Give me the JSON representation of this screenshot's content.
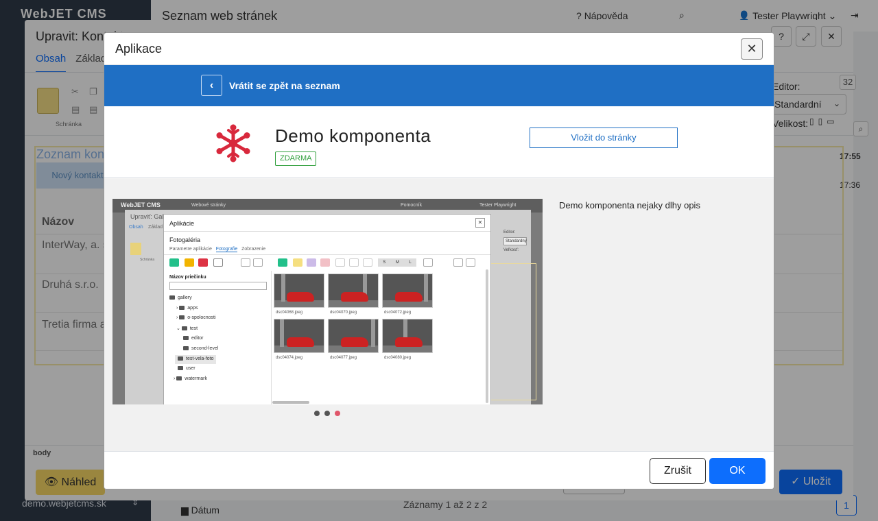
{
  "background": {
    "logo": "WebJET CMS",
    "page_title": "Seznam web stránek",
    "help_label": "Nápověda",
    "user_label": "Tester Playwright",
    "domain": "demo.webjetcms.sk",
    "records_text": "Záznamy 1 až 2 z 2",
    "page_number": "1",
    "folder_label": "Dátum"
  },
  "editor": {
    "title": "Upravit: Kontakt",
    "tabs": [
      {
        "label": "Obsah",
        "active": true
      },
      {
        "label": "Základní",
        "active": false
      }
    ],
    "clipboard_label": "Schránka",
    "editor_label": "Editor:",
    "editor_select_value": "Standardní",
    "size_label": "Velikost:",
    "content_heading": "Zoznam kontaktov",
    "content_button": "Nový kontakt",
    "content_column": "Názov",
    "content_rows": [
      "InterWay, a. s.",
      "Druhá s.r.o.",
      "Tretia firma a.s."
    ],
    "body_label": "body",
    "preview_label": "Náhled",
    "save_label": "Uložit",
    "side_number": "32",
    "time_1": "17:55",
    "time_2": "17:36"
  },
  "modal": {
    "title": "Aplikace",
    "back_label": "Vrátit se zpět na seznam",
    "app_name": "Demo komponenta",
    "badge": "ZDARMA",
    "insert_label": "Vložit do stránky",
    "description": "Demo komponenta nejaky dlhy opis",
    "cancel_label": "Zrušit",
    "ok_label": "OK",
    "carousel": {
      "total": 3,
      "active_index": 2
    }
  },
  "screenshot": {
    "logo": "WebJET CMS",
    "top_title": "Webové stránky",
    "top_help": "Pomocník",
    "top_user": "Tester Playwright",
    "editor_title": "Upraviť: Galéria",
    "tab_obsah": "Obsah",
    "tab_zaklad": "Základ",
    "window_title": "Aplikácie",
    "subtitle": "Fotogaléria",
    "tabs": [
      "Parametre aplikácie",
      "Fotografie",
      "Zobrazenie"
    ],
    "active_tab": "Fotografie",
    "tree_label": "Názov priečinku",
    "tree": [
      "gallery",
      "apps",
      "o-spolocnosti",
      "test",
      "editor",
      "second-level",
      "test-vela-foto",
      "user",
      "watermark"
    ],
    "size_buttons": [
      "S",
      "M",
      "L"
    ],
    "photos": [
      "dsc04068.jpeg",
      "dsc04070.jpeg",
      "dsc04072.jpeg",
      "dsc04074.jpeg",
      "dsc04077.jpeg",
      "dsc04080.jpeg"
    ],
    "editor_label": "Editor:",
    "editor_value": "Standardný",
    "size_label": "Veľkosť:",
    "clipboard_label": "Schránka"
  }
}
